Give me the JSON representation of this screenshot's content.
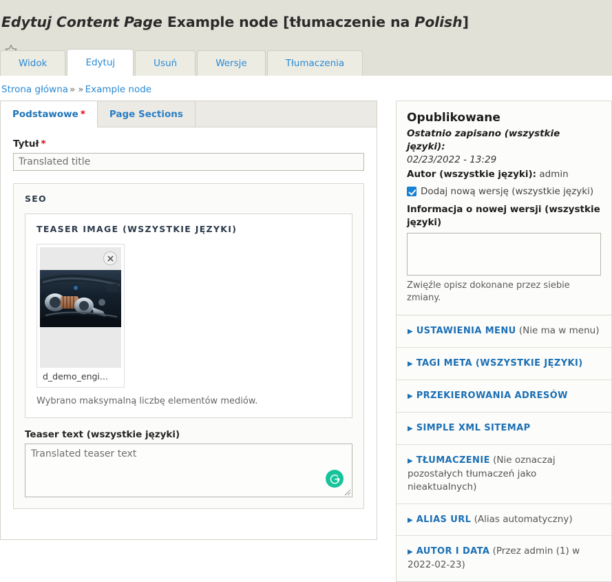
{
  "header": {
    "title_italic_1": "Edytuj Content Page",
    "title_plain_1": " Example node [tłumaczenie na ",
    "title_italic_2": "Polish",
    "title_plain_2": "]",
    "star_icon": "star-outline-icon"
  },
  "primary_tabs": [
    {
      "label": "Widok",
      "active": false
    },
    {
      "label": "Edytuj",
      "active": true
    },
    {
      "label": "Usuń",
      "active": false
    },
    {
      "label": "Wersje",
      "active": false
    },
    {
      "label": "Tłumaczenia",
      "active": false
    }
  ],
  "breadcrumb": {
    "home": "Strona główna",
    "sep1": "»",
    "sep2": "»",
    "current": "Example node"
  },
  "subtabs": [
    {
      "label": "Podstawowe",
      "required_marker": "*",
      "active": true
    },
    {
      "label": "Page Sections",
      "required_marker": "",
      "active": false
    }
  ],
  "form": {
    "title_label": "Tytuł",
    "title_required": "*",
    "title_value": "",
    "title_placeholder": "Translated title",
    "seo_legend": "SEO",
    "teaser_image_legend": "TEASER IMAGE (WSZYSTKIE JĘZYKI)",
    "media_file_name": "d_demo_engi...",
    "media_remove_icon": "close-icon",
    "media_hint": "Wybrano maksymalną liczbę elementów mediów.",
    "teaser_text_label": "Teaser text (wszystkie języki)",
    "teaser_text_value": "",
    "teaser_text_placeholder": "Translated teaser text",
    "grammarly_glyph": "G"
  },
  "sidebar": {
    "status": "Opublikowane",
    "last_saved_label": "Ostatnio zapisano (wszystkie języki):",
    "last_saved_value": "02/23/2022 - 13:29",
    "author_label": "Autor (wszystkie języki):",
    "author_value": "admin",
    "new_revision_label": "Dodaj nową wersję (wszystkie języki)",
    "new_revision_checked": true,
    "revision_log_label": "Informacja o nowej wersji (wszystkie języki)",
    "revision_log_value": "",
    "revision_log_hint": "Zwięźle opisz dokonane przez siebie zmiany."
  },
  "accordion": [
    {
      "title": "USTAWIENIA MENU",
      "summary": "(Nie ma w menu)"
    },
    {
      "title": "TAGI META (WSZYSTKIE JĘZYKI)",
      "summary": ""
    },
    {
      "title": "PRZEKIEROWANIA ADRESÓW",
      "summary": ""
    },
    {
      "title": "SIMPLE XML SITEMAP",
      "summary": ""
    },
    {
      "title": "TŁUMACZENIE",
      "summary": "(Nie oznaczaj pozostałych tłumaczeń jako nieaktualnych)"
    },
    {
      "title": "ALIAS URL",
      "summary": "(Alias automatyczny)"
    },
    {
      "title": "AUTOR I DATA",
      "summary": "(Przez admin (1) w 2022-02-23)"
    }
  ],
  "colors": {
    "header_band": "#e2e1d7",
    "link_blue": "#2a8ad4",
    "accordion_blue": "#1a6fb5",
    "required_red": "#e0000f",
    "checkbox_blue": "#1883d7",
    "grammarly_green": "#17c39a"
  }
}
